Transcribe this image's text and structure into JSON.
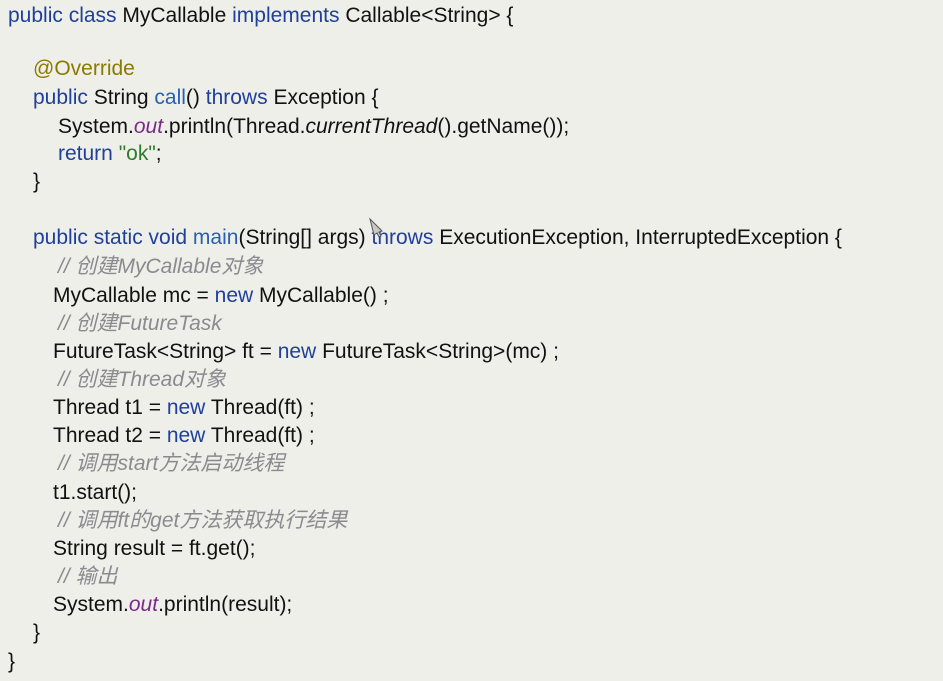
{
  "lines": [
    {
      "segments": [
        {
          "t": "public class ",
          "c": "kw"
        },
        {
          "t": "MyCallable ",
          "c": ""
        },
        {
          "t": "implements ",
          "c": "kw"
        },
        {
          "t": "Callable<String> {",
          "c": ""
        }
      ]
    },
    {
      "segments": [
        {
          "t": "@Override",
          "c": "ann"
        }
      ]
    },
    {
      "segments": [
        {
          "t": "public ",
          "c": "kw"
        },
        {
          "t": "String ",
          "c": ""
        },
        {
          "t": "call",
          "c": "fn"
        },
        {
          "t": "() ",
          "c": ""
        },
        {
          "t": "throws ",
          "c": "kw"
        },
        {
          "t": "Exception {",
          "c": ""
        }
      ]
    },
    {
      "segments": [
        {
          "t": "System.",
          "c": ""
        },
        {
          "t": "out",
          "c": "fld"
        },
        {
          "t": ".println(Thread.",
          "c": ""
        },
        {
          "t": "currentThread",
          "c": "ital"
        },
        {
          "t": "().getName());",
          "c": ""
        }
      ]
    },
    {
      "segments": [
        {
          "t": "return ",
          "c": "kw"
        },
        {
          "t": "\"ok\"",
          "c": "str"
        },
        {
          "t": ";",
          "c": ""
        }
      ]
    },
    {
      "segments": [
        {
          "t": "}",
          "c": ""
        }
      ]
    },
    {
      "segments": [
        {
          "t": "public static void ",
          "c": "kw"
        },
        {
          "t": "main",
          "c": "fn"
        },
        {
          "t": "(String[] args) ",
          "c": ""
        },
        {
          "t": "throws ",
          "c": "kw"
        },
        {
          "t": "ExecutionException, InterruptedException {",
          "c": ""
        }
      ]
    },
    {
      "segments": [
        {
          "t": "// 创建MyCallable对象",
          "c": "cmt"
        }
      ]
    },
    {
      "segments": [
        {
          "t": "MyCallable mc = ",
          "c": ""
        },
        {
          "t": "new ",
          "c": "kw"
        },
        {
          "t": "MyCallable() ;",
          "c": ""
        }
      ]
    },
    {
      "segments": [
        {
          "t": "// 创建FutureTask",
          "c": "cmt"
        }
      ]
    },
    {
      "segments": [
        {
          "t": "FutureTask<String> ft = ",
          "c": ""
        },
        {
          "t": "new ",
          "c": "kw"
        },
        {
          "t": "FutureTask<String>(mc) ;",
          "c": ""
        }
      ]
    },
    {
      "segments": [
        {
          "t": "// 创建Thread对象",
          "c": "cmt"
        }
      ]
    },
    {
      "segments": [
        {
          "t": "Thread t1 = ",
          "c": ""
        },
        {
          "t": "new ",
          "c": "kw"
        },
        {
          "t": "Thread(ft) ;",
          "c": ""
        }
      ]
    },
    {
      "segments": [
        {
          "t": "Thread t2 = ",
          "c": ""
        },
        {
          "t": "new ",
          "c": "kw"
        },
        {
          "t": "Thread(ft) ;",
          "c": ""
        }
      ]
    },
    {
      "segments": [
        {
          "t": "// 调用start方法启动线程",
          "c": "cmt"
        }
      ]
    },
    {
      "segments": [
        {
          "t": "t1.start();",
          "c": ""
        }
      ]
    },
    {
      "segments": [
        {
          "t": "// 调用ft的get方法获取执行结果",
          "c": "cmt"
        }
      ]
    },
    {
      "segments": [
        {
          "t": "String result = ft.get();",
          "c": ""
        }
      ]
    },
    {
      "segments": [
        {
          "t": "// 输出",
          "c": "cmt"
        }
      ]
    },
    {
      "segments": [
        {
          "t": "System.",
          "c": ""
        },
        {
          "t": "out",
          "c": "fld"
        },
        {
          "t": ".println(result);",
          "c": ""
        }
      ]
    },
    {
      "segments": [
        {
          "t": "}",
          "c": ""
        }
      ]
    },
    {
      "segments": [
        {
          "t": "}",
          "c": ""
        }
      ]
    }
  ],
  "colors": {
    "background": "#eeefe9",
    "keyword": "#1f3f9a",
    "method": "#2a5fb0",
    "annotation": "#8a7a00",
    "string": "#2f7a2f",
    "field": "#7a2a8a",
    "comment": "#8a8a90"
  },
  "cursor_icon": "pointer-cursor-icon"
}
